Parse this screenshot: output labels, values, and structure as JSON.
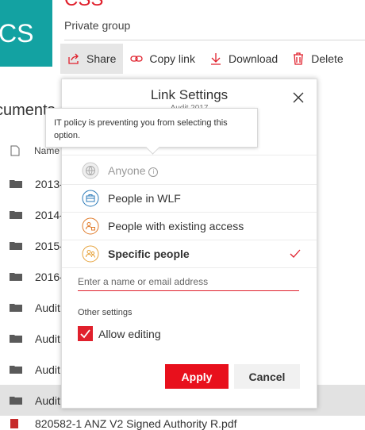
{
  "site": {
    "logo_text": "CS",
    "title": "CSS",
    "subtitle": "Private group"
  },
  "toolbar": {
    "share_label": "Share",
    "copy_link_label": "Copy link",
    "download_label": "Download",
    "delete_label": "Delete"
  },
  "library": {
    "heading": "cuments",
    "column_name": "Name",
    "rows": [
      "2013-",
      "2014-",
      "2015-",
      "2016-",
      "Audit",
      "Audit",
      "Audit",
      "Audit"
    ],
    "bottom_file": "820582-1 ANZ V2 Signed Authority R.pdf"
  },
  "dialog": {
    "title": "Link Settings",
    "subtitle": "Audit 2017",
    "tooltip": "IT policy is preventing you from selecting this option.",
    "options": [
      {
        "label": "Anyone",
        "icon": "globe-icon",
        "disabled": true
      },
      {
        "label": "People in WLF",
        "icon": "briefcase-icon"
      },
      {
        "label": "People with existing access",
        "icon": "people-lock-icon"
      },
      {
        "label": "Specific people",
        "icon": "people-icon",
        "selected": true
      }
    ],
    "input_placeholder": "Enter a name or email address",
    "other_settings": "Other settings",
    "allow_editing_label": "Allow editing",
    "allow_editing_checked": true,
    "apply_label": "Apply",
    "cancel_label": "Cancel"
  },
  "colors": {
    "brand_red": "#e0202c",
    "logo_teal": "#13a2a2",
    "anyone_grey": "#9e9e9e",
    "wlf_blue": "#2a7ab8",
    "people_orange": "#e07b2a",
    "specific_gold": "#e6a23a"
  }
}
